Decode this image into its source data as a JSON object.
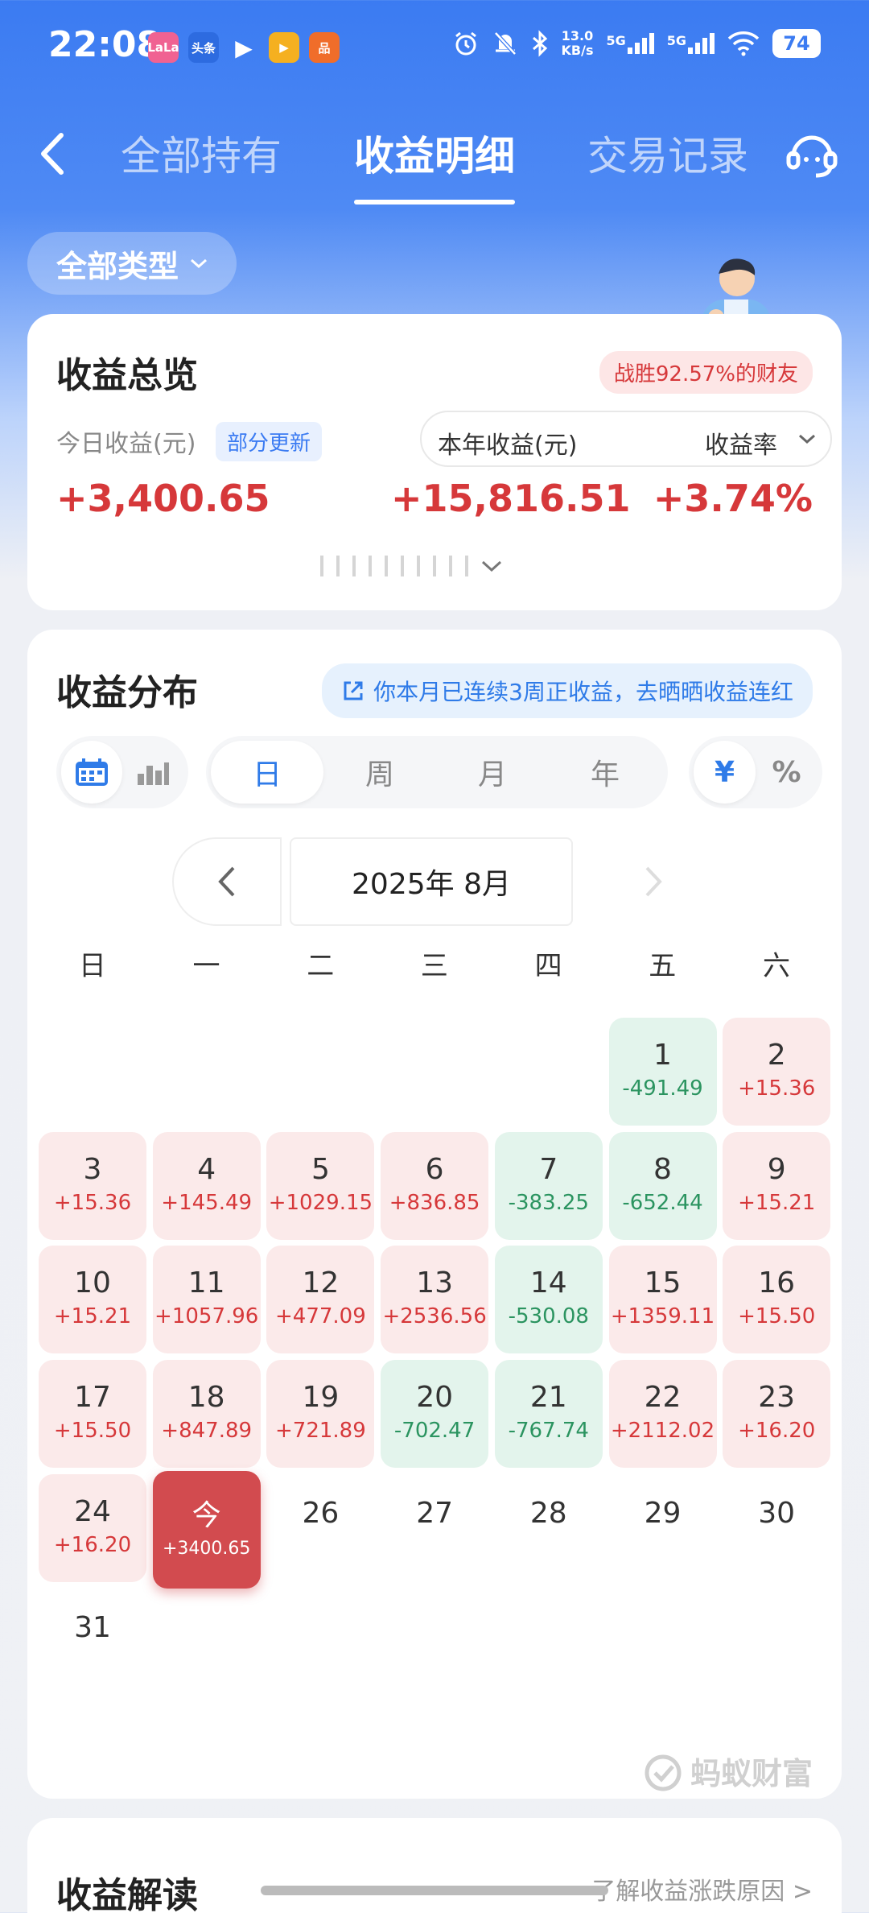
{
  "status_bar": {
    "time": "22:08",
    "net_speed": "13.0",
    "net_unit": "KB/s",
    "sim1": "5G",
    "sim2": "5G",
    "battery": "74",
    "app_icons": [
      "LaLa",
      "头条",
      "▶",
      "▶",
      "品"
    ]
  },
  "nav": {
    "tabs": [
      "全部持有",
      "收益明细",
      "交易记录"
    ],
    "active_tab": "收益明细"
  },
  "filter": {
    "label": "全部类型"
  },
  "overview": {
    "title": "收益总览",
    "rank_badge": "战胜92.57%的财友",
    "today_label": "今日收益(元)",
    "partial_update": "部分更新",
    "year_label": "本年收益(元)",
    "rate_label": "收益率",
    "today_value": "+3,400.65",
    "year_value": "+15,816.51",
    "rate_value": "+3.74%"
  },
  "distribution": {
    "title": "收益分布",
    "share_chip": "你本月已连续3周正收益，去晒晒收益连红",
    "periods": [
      "日",
      "周",
      "月",
      "年"
    ],
    "active_period": "日",
    "units": [
      "¥",
      "%"
    ],
    "month_label": "2025年 8月",
    "weekdays": [
      "日",
      "一",
      "二",
      "三",
      "四",
      "五",
      "六"
    ],
    "days": [
      {
        "d": "1",
        "v": "-491.49",
        "t": "neg"
      },
      {
        "d": "2",
        "v": "+15.36",
        "t": "pos"
      },
      {
        "d": "3",
        "v": "+15.36",
        "t": "pos"
      },
      {
        "d": "4",
        "v": "+145.49",
        "t": "pos"
      },
      {
        "d": "5",
        "v": "+1029.15",
        "t": "pos"
      },
      {
        "d": "6",
        "v": "+836.85",
        "t": "pos"
      },
      {
        "d": "7",
        "v": "-383.25",
        "t": "neg"
      },
      {
        "d": "8",
        "v": "-652.44",
        "t": "neg"
      },
      {
        "d": "9",
        "v": "+15.21",
        "t": "pos"
      },
      {
        "d": "10",
        "v": "+15.21",
        "t": "pos"
      },
      {
        "d": "11",
        "v": "+1057.96",
        "t": "pos"
      },
      {
        "d": "12",
        "v": "+477.09",
        "t": "pos"
      },
      {
        "d": "13",
        "v": "+2536.56",
        "t": "pos"
      },
      {
        "d": "14",
        "v": "-530.08",
        "t": "neg"
      },
      {
        "d": "15",
        "v": "+1359.11",
        "t": "pos"
      },
      {
        "d": "16",
        "v": "+15.50",
        "t": "pos"
      },
      {
        "d": "17",
        "v": "+15.50",
        "t": "pos"
      },
      {
        "d": "18",
        "v": "+847.89",
        "t": "pos"
      },
      {
        "d": "19",
        "v": "+721.89",
        "t": "pos"
      },
      {
        "d": "20",
        "v": "-702.47",
        "t": "neg"
      },
      {
        "d": "21",
        "v": "-767.74",
        "t": "neg"
      },
      {
        "d": "22",
        "v": "+2112.02",
        "t": "pos"
      },
      {
        "d": "23",
        "v": "+16.20",
        "t": "pos"
      },
      {
        "d": "24",
        "v": "+16.20",
        "t": "pos"
      },
      {
        "d": "今",
        "v": "+3400.65",
        "t": "today"
      },
      {
        "d": "26",
        "v": "",
        "t": "empty"
      },
      {
        "d": "27",
        "v": "",
        "t": "empty"
      },
      {
        "d": "28",
        "v": "",
        "t": "empty"
      },
      {
        "d": "29",
        "v": "",
        "t": "empty"
      },
      {
        "d": "30",
        "v": "",
        "t": "empty"
      },
      {
        "d": "31",
        "v": "",
        "t": "empty"
      }
    ],
    "first_weekday": 5,
    "watermark": "蚂蚁财富"
  },
  "interpretation": {
    "title": "收益解读",
    "link": "了解收益涨跌原因 >"
  },
  "colors": {
    "header_blue": "#3b7bf2",
    "gain_red": "#d6383a",
    "loss_green": "#2b9460",
    "today_bg": "#d24b4f"
  }
}
